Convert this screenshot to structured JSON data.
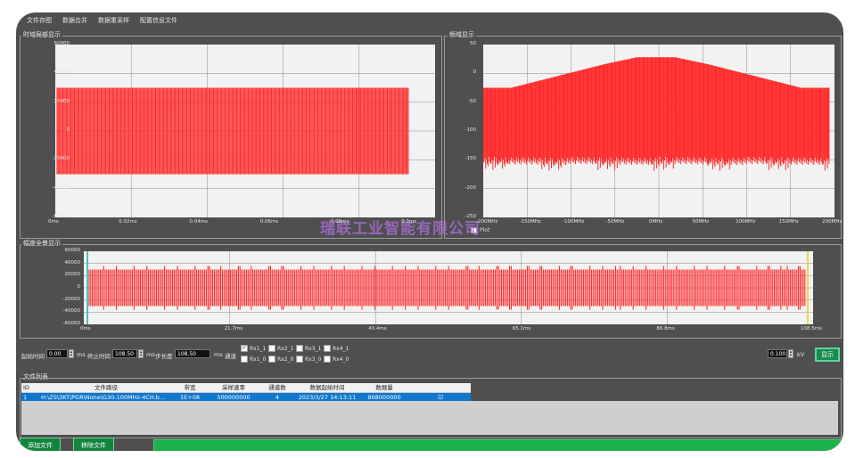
{
  "menu": [
    "文件存图",
    "数据合并",
    "数据重采样",
    "配置信息文件"
  ],
  "time_panel": {
    "title": "时域局部显示",
    "y_ticks": [
      "60000",
      "40000",
      "20000",
      "0",
      "-20000",
      "-40000",
      "-60000"
    ],
    "x_ticks": [
      "0ms",
      "0.02ms",
      "0.04ms",
      "0.06ms",
      "0.08ms",
      "0.1ms"
    ],
    "amplitude": 30000
  },
  "freq_panel": {
    "title": "频域显示",
    "y_ticks": [
      "50",
      "0",
      "-50",
      "-100",
      "-150",
      "-200",
      "-250"
    ],
    "x_ticks": [
      "-200MHz",
      "-150MHz",
      "-100MHz",
      "-50MHz",
      "0MHz",
      "50MHz",
      "100MHz",
      "150MHz",
      "200MHz"
    ],
    "legend_label": "Plot"
  },
  "overview_panel": {
    "title": "幅度全景显示",
    "y_ticks": [
      "60000",
      "40000",
      "20000",
      "0",
      "-20000",
      "-40000",
      "-60000"
    ],
    "x_ticks": [
      "0ms",
      "21.7ms",
      "43.4ms",
      "65.1ms",
      "86.8ms",
      "108.5ms"
    ]
  },
  "controls": {
    "start_label": "起始时间",
    "start_value": "0.00",
    "stop_label": "终止时间",
    "stop_value": "108.50",
    "unit_ms": "ms",
    "step_label": "步长度",
    "step_value": "108.50",
    "channel_label": "通道",
    "channels": [
      {
        "label": "Rx1_1",
        "checked": true
      },
      {
        "label": "Rx2_1",
        "checked": false
      },
      {
        "label": "Rx3_1",
        "checked": false
      },
      {
        "label": "Rx4_1",
        "checked": false
      },
      {
        "label": "Rx1_0",
        "checked": false
      },
      {
        "label": "Rx2_0",
        "checked": false
      },
      {
        "label": "Rx3_0",
        "checked": false
      },
      {
        "label": "Rx4_0",
        "checked": false
      }
    ],
    "kv_value": "0.100",
    "kv_unit": "kV",
    "show_button": "显示"
  },
  "file_list": {
    "title": "文件列表",
    "columns": [
      "ID",
      "文件路径",
      "带宽",
      "采样速率",
      "通道数",
      "数据起始时间",
      "数据量",
      ""
    ],
    "rows": [
      {
        "id": "1",
        "path": "H:\\ZS\\ЗKT\\PGR\\None\\G30-100MHz-4CH.b...",
        "bandwidth": "1E+08",
        "sample_rate": "500000000",
        "channels": "4",
        "start_time": "2023/3/27 14:13:11",
        "data_size": "868000000",
        "check": "☑"
      }
    ]
  },
  "bottom": {
    "add_button": "添加文件",
    "remove_button": "移除文件",
    "progress": 1.0
  },
  "watermark": "瑞联工业智能有限公司",
  "colors": {
    "signal": "#ff2b2b",
    "background": "#4f4f4f",
    "plot": "#f2f2f2",
    "selected_row": "#1177cc"
  }
}
